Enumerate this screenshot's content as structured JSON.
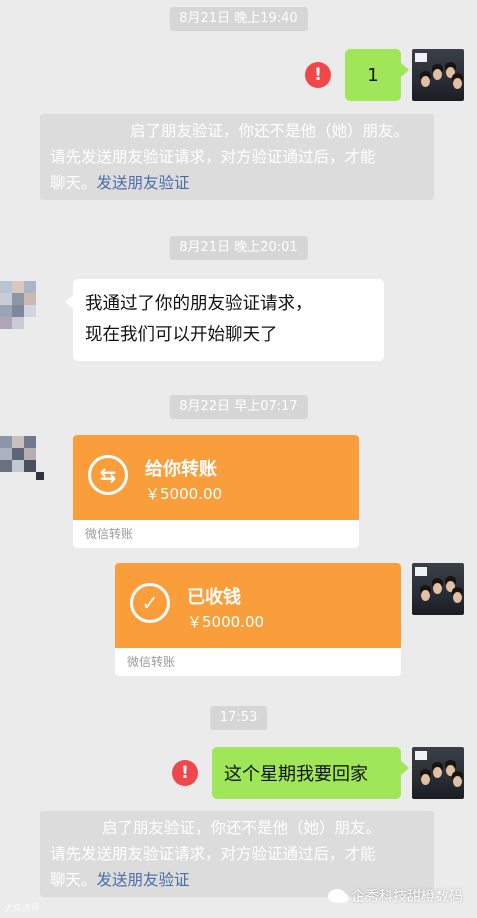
{
  "colors": {
    "background": "#ebebeb",
    "green_bubble": "#9fe658",
    "transfer_orange": "#fa9e3b",
    "error_red": "#f0474b",
    "link_blue": "#4a6da8"
  },
  "timestamps": [
    "8月21日 晚上19:40",
    "8月21日 晚上20:01",
    "8月22日 早上07:17",
    "17:53"
  ],
  "messages": {
    "m1": {
      "text": "1",
      "status_icon": "exclamation-icon"
    },
    "sys1": {
      "line1": "启了朋友验证，你还不是他（她）朋友。",
      "line2": "请先发送朋友验证请求，对方验证通过后，才能",
      "line3_prefix": "聊天。",
      "link": "发送朋友验证"
    },
    "m2": {
      "line1": "我通过了你的朋友验证请求，",
      "line2": "现在我们可以开始聊天了"
    },
    "transfer_in": {
      "title": "给你转账",
      "amount": "￥5000.00",
      "footer": "微信转账",
      "icon": "transfer-arrows-icon"
    },
    "transfer_done": {
      "title": "已收钱",
      "amount": "￥5000.00",
      "footer": "微信转账",
      "icon": "checkmark-icon"
    },
    "m3": {
      "text": "这个星期我要回家",
      "status_icon": "exclamation-icon"
    },
    "sys2": {
      "line1": "启了朋友验证，你还不是他（她）朋友。",
      "line2": "请先发送朋友验证请求，对方验证通过后，才能",
      "line3_prefix": "聊天。",
      "link": "发送朋友验证"
    }
  },
  "watermark": {
    "right_text": "企秀科技甜橙数码",
    "left_text": "大众点评"
  }
}
